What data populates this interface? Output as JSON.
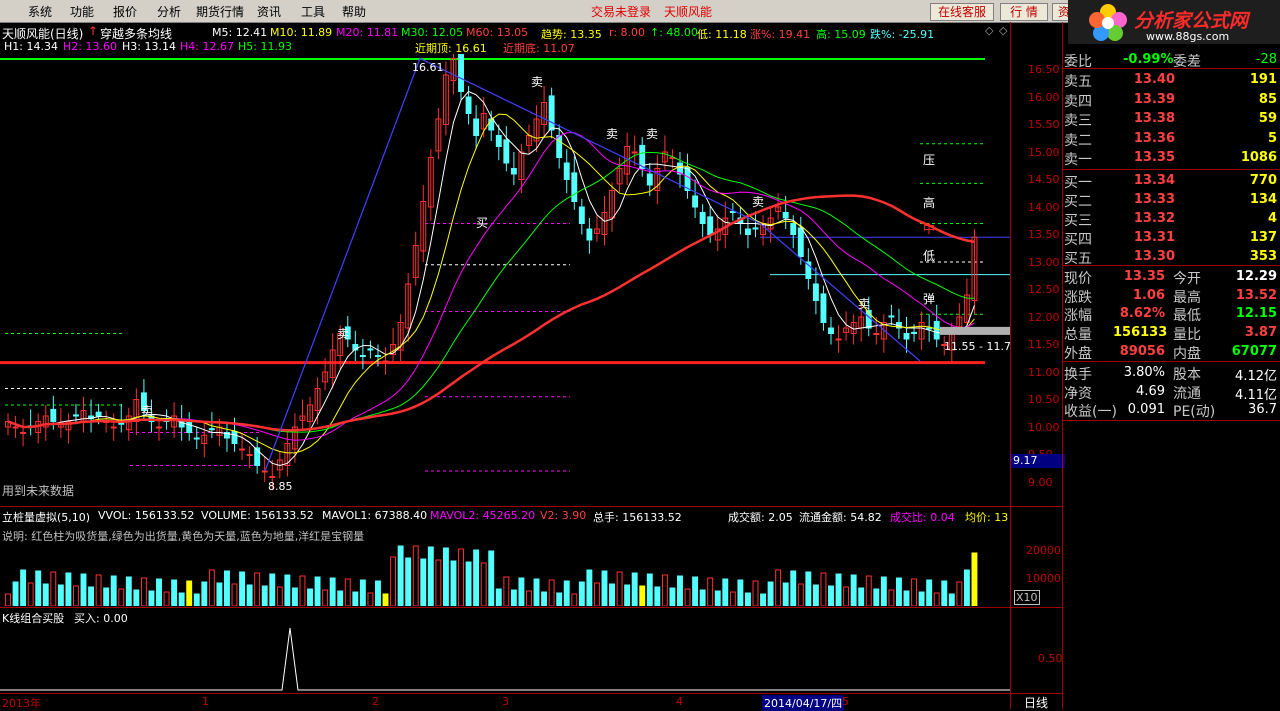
{
  "menu": {
    "items": [
      "系统",
      "功能",
      "报价",
      "分析",
      "期货行情",
      "资讯",
      "工具",
      "帮助"
    ],
    "login_status": "交易未登录",
    "stock_name": "天顺风能",
    "online_service": "在线客服",
    "quote": "行 情",
    "info": "资"
  },
  "logo": {
    "text": "分析家公式网",
    "url": "www.88gs.com"
  },
  "chart_header": {
    "title": "天顺风能(日线)",
    "formula": "穿越多条均线",
    "ma": [
      {
        "label": "M5: 12.41",
        "color": "#ffffff"
      },
      {
        "label": "M10: 11.89",
        "color": "#ffff00"
      },
      {
        "label": "M20: 11.81",
        "color": "#ff00ff"
      },
      {
        "label": "M30: 12.05",
        "color": "#00ff00"
      },
      {
        "label": "M60: 13.05",
        "color": "#ff4040"
      }
    ],
    "trend": "趋势: 13.35",
    "r": "r: 8.00",
    "v48": "↑: 48.00",
    "low": "低: 11.18",
    "rise": "涨%: 19.41",
    "high": "高: 15.09",
    "fall": "跌%: -25.91",
    "h_levels": [
      {
        "label": "H1: 14.34",
        "color": "#ffffff"
      },
      {
        "label": "H2: 13.60",
        "color": "#ff00ff"
      },
      {
        "label": "H3: 13.14",
        "color": "#ffffff"
      },
      {
        "label": "H4: 12.67",
        "color": "#ff00ff"
      },
      {
        "label": "H5: 11.93",
        "color": "#00ff00"
      }
    ],
    "recent_top": "近期顶: 16.61",
    "recent_bottom": "近期底: 11.07"
  },
  "price_axis": [
    "16.50",
    "16.00",
    "15.50",
    "15.00",
    "14.50",
    "14.00",
    "13.50",
    "13.00",
    "12.50",
    "12.00",
    "11.50",
    "11.00",
    "10.50",
    "10.00",
    "9.50",
    "9.00"
  ],
  "price_marker": "9.17",
  "annotations": {
    "sell": "卖",
    "buy": "买",
    "high_label": "高",
    "low_label": "低",
    "press": "压",
    "mid": "中",
    "bounce": "弹",
    "range": "11.55 - 11.7",
    "peak": "16.61",
    "low_mark": "8.85",
    "future_data": "用到未来数据"
  },
  "volume_header": {
    "title": "立桩量虚拟(5,10)",
    "vvol": "VVOL: 156133.52",
    "volume": "VOLUME: 156133.52",
    "mavol1": "MAVOL1: 67388.40",
    "mavol2": "MAVOL2: 45265.20",
    "v2": "V2: 3.90",
    "total": "总手: 156133.52",
    "amount": "成交额: 2.05",
    "flow_amount": "流通金额: 54.82",
    "ratio": "成交比: 0.04",
    "avg": "均价: 13",
    "desc": "说明: 红色柱为吸货量,绿色为出货量,黄色为天量,蓝色为地量,洋红是宝钢量"
  },
  "volume_axis": [
    "20000",
    "10000"
  ],
  "volume_unit": "X10",
  "indicator": {
    "title": "K线组合买股",
    "value": "买入: 0.00",
    "axis": "0.50"
  },
  "xaxis": {
    "year": "2013年",
    "m1": "1",
    "m2": "2",
    "m3": "3",
    "m4": "4",
    "date": "2014/04/17/四",
    "m5": "5"
  },
  "period": "日线",
  "quote": {
    "header_left": "委比",
    "header_val": "-0.99%",
    "header_right": "委差",
    "header_right_val": "-28",
    "asks": [
      {
        "label": "卖五",
        "price": "13.40",
        "vol": "191"
      },
      {
        "label": "卖四",
        "price": "13.39",
        "vol": "85"
      },
      {
        "label": "卖三",
        "price": "13.38",
        "vol": "59"
      },
      {
        "label": "卖二",
        "price": "13.36",
        "vol": "5"
      },
      {
        "label": "卖一",
        "price": "13.35",
        "vol": "1086"
      }
    ],
    "bids": [
      {
        "label": "买一",
        "price": "13.34",
        "vol": "770"
      },
      {
        "label": "买二",
        "price": "13.33",
        "vol": "134"
      },
      {
        "label": "买三",
        "price": "13.32",
        "vol": "4"
      },
      {
        "label": "买四",
        "price": "13.31",
        "vol": "137"
      },
      {
        "label": "买五",
        "price": "13.30",
        "vol": "353"
      }
    ],
    "stats": [
      {
        "l1": "现价",
        "v1": "13.35",
        "c1": "#ff4040",
        "l2": "今开",
        "v2": "12.29",
        "c2": "#ffffff"
      },
      {
        "l1": "涨跌",
        "v1": "1.06",
        "c1": "#ff4040",
        "l2": "最高",
        "v2": "13.52",
        "c2": "#ff4040"
      },
      {
        "l1": "涨幅",
        "v1": "8.62%",
        "c1": "#ff4040",
        "l2": "最低",
        "v2": "12.15",
        "c2": "#00ff00"
      },
      {
        "l1": "总量",
        "v1": "156133",
        "c1": "#ffff00",
        "l2": "量比",
        "v2": "3.87",
        "c2": "#ff4040"
      },
      {
        "l1": "外盘",
        "v1": "89056",
        "c1": "#ff4040",
        "l2": "内盘",
        "v2": "67077",
        "c2": "#00ff00"
      }
    ],
    "stats2": [
      {
        "l1": "换手",
        "v1": "3.80%",
        "l2": "股本",
        "v2": "4.12亿"
      },
      {
        "l1": "净资",
        "v1": "4.69",
        "l2": "流通",
        "v2": "4.11亿"
      },
      {
        "l1": "收益(一)",
        "v1": "0.091",
        "l2": "PE(动)",
        "v2": "36.7"
      }
    ]
  },
  "colors": {
    "up": "#ff3030",
    "down": "#54ffff",
    "grid": "#a00000",
    "bg": "#000000"
  }
}
